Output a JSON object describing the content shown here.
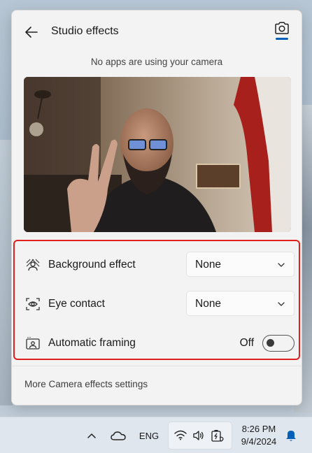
{
  "header": {
    "title": "Studio effects"
  },
  "status": {
    "text": "No apps are using your camera"
  },
  "options": {
    "background_effect": {
      "label": "Background effect",
      "value": "None"
    },
    "eye_contact": {
      "label": "Eye contact",
      "value": "None"
    },
    "automatic_framing": {
      "label": "Automatic framing",
      "state": "Off"
    }
  },
  "footer": {
    "more_link": "More Camera effects settings"
  },
  "taskbar": {
    "language": "ENG",
    "time": "8:26 PM",
    "date": "9/4/2024"
  },
  "colors": {
    "accent": "#005fb8",
    "highlight_border": "#e0201c"
  }
}
